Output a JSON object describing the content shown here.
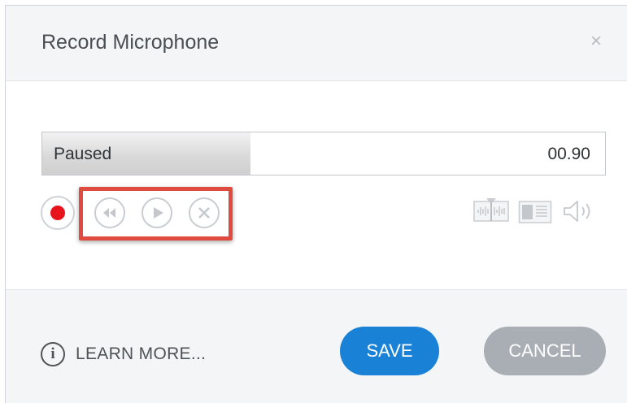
{
  "dialog": {
    "title": "Record Microphone",
    "close_label": "×"
  },
  "recorder": {
    "status": "Paused",
    "time": "00.90",
    "progress_fraction": 0.37
  },
  "icons": {
    "record": "record-icon",
    "rewind": "rewind-icon",
    "play": "play-icon",
    "delete": "delete-icon",
    "waveform": "waveform-icon",
    "layout": "layout-icon",
    "volume": "volume-icon"
  },
  "footer": {
    "info_glyph": "i",
    "learn_more": "LEARN MORE...",
    "save_label": "SAVE",
    "cancel_label": "CANCEL"
  },
  "colors": {
    "accent": "#1a82d6",
    "record": "#e8141b",
    "highlight": "#e04b40",
    "cancel": "#a9aeb4"
  }
}
